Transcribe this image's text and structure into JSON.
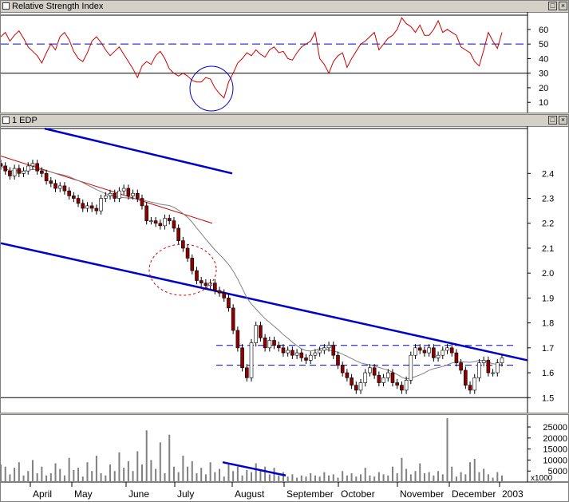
{
  "panes": {
    "rsi": {
      "title": "Relative Strength Index"
    },
    "price": {
      "title": "1 EDP"
    },
    "volume": {
      "title": ""
    }
  },
  "icons": {
    "maximize": "maximize-icon",
    "close": "close-icon"
  },
  "colors": {
    "rsi_line": "#cc0000",
    "trendline": "#0000cc",
    "up_candle": "#ffffff",
    "down_candle": "#8b0000",
    "ma": "#808080",
    "volume_bar": "#808080"
  },
  "x_axis": {
    "months": [
      "April",
      "May",
      "June",
      "July",
      "August",
      "September",
      "October",
      "November",
      "December",
      "2003"
    ]
  },
  "chart_data": [
    {
      "type": "line",
      "title": "Relative Strength Index",
      "ylim": [
        3,
        72
      ],
      "y_ticks": [
        "10",
        "20",
        "30",
        "40",
        "50",
        "60"
      ],
      "reference_lines": [
        50,
        30
      ],
      "series": [
        {
          "values": [
            55,
            58,
            52,
            56,
            59,
            54,
            48,
            45,
            42,
            37,
            44,
            50,
            46,
            55,
            58,
            53,
            45,
            40,
            38,
            44,
            52,
            55,
            51,
            46,
            42,
            45,
            48,
            43,
            38,
            33,
            27,
            35,
            38,
            36,
            42,
            45,
            40,
            33,
            30,
            28,
            30,
            28,
            25,
            24,
            24,
            27,
            26,
            20,
            16,
            13,
            24,
            30,
            37,
            40,
            44,
            42,
            46,
            43,
            41,
            46,
            48,
            44,
            45,
            40,
            39,
            44,
            48,
            50,
            52,
            58,
            40,
            36,
            30,
            38,
            42,
            44,
            34,
            40,
            45,
            50,
            52,
            55,
            58,
            46,
            50,
            54,
            56,
            60,
            68,
            64,
            62,
            58,
            63,
            56,
            56,
            60,
            66,
            58,
            60,
            58,
            56,
            48,
            46,
            44,
            38,
            35,
            46,
            58,
            52,
            47,
            58
          ]
        }
      ]
    },
    {
      "type": "candlestick",
      "title": "1 EDP",
      "ylim": [
        1.44,
        2.59
      ],
      "y_ticks": [
        "1.5",
        "1.6",
        "1.7",
        "1.8",
        "1.9",
        "2.0",
        "2.1",
        "2.2",
        "2.3",
        "2.4"
      ],
      "close": [
        2.43,
        2.41,
        2.39,
        2.42,
        2.4,
        2.41,
        2.43,
        2.44,
        2.41,
        2.4,
        2.37,
        2.36,
        2.34,
        2.35,
        2.33,
        2.31,
        2.3,
        2.28,
        2.26,
        2.27,
        2.26,
        2.25,
        2.3,
        2.31,
        2.32,
        2.3,
        2.33,
        2.34,
        2.31,
        2.32,
        2.3,
        2.27,
        2.21,
        2.21,
        2.2,
        2.19,
        2.22,
        2.21,
        2.18,
        2.13,
        2.1,
        2.06,
        2.01,
        1.97,
        1.96,
        1.95,
        1.96,
        1.93,
        1.92,
        1.9,
        1.86,
        1.77,
        1.7,
        1.62,
        1.58,
        1.72,
        1.79,
        1.74,
        1.7,
        1.73,
        1.71,
        1.7,
        1.68,
        1.69,
        1.67,
        1.68,
        1.66,
        1.65,
        1.67,
        1.68,
        1.69,
        1.7,
        1.71,
        1.67,
        1.63,
        1.6,
        1.58,
        1.55,
        1.53,
        1.56,
        1.6,
        1.62,
        1.59,
        1.56,
        1.58,
        1.6,
        1.56,
        1.55,
        1.53,
        1.57,
        1.67,
        1.7,
        1.69,
        1.68,
        1.7,
        1.66,
        1.67,
        1.69,
        1.7,
        1.68,
        1.64,
        1.61,
        1.55,
        1.53,
        1.58,
        1.64,
        1.65,
        1.6,
        1.6,
        1.64,
        1.66
      ],
      "trendlines": [
        {
          "from": [
            0,
            2.58
          ],
          "to": [
            1,
            2.4
          ]
        },
        {
          "from": [
            0,
            2.12
          ],
          "to": [
            1,
            1.65
          ]
        },
        {
          "from": [
            0,
            2.47
          ],
          "to": [
            1,
            2.2
          ]
        }
      ],
      "horizontal_levels": [
        1.71,
        1.63,
        1.5
      ]
    },
    {
      "type": "bar",
      "title": "",
      "ylim": [
        0,
        29000
      ],
      "y_ticks": [
        "5000",
        "10000",
        "15000",
        "20000",
        "25000"
      ],
      "unit_label": "x1000",
      "values": [
        8000,
        7000,
        3500,
        6500,
        9000,
        3000,
        5000,
        10000,
        4000,
        7000,
        3000,
        4000,
        8500,
        6000,
        3000,
        11000,
        5500,
        6500,
        2500,
        9000,
        5000,
        12000,
        4000,
        3000,
        8000,
        5000,
        13500,
        6500,
        9500,
        5000,
        14000,
        8000,
        23500,
        10000,
        6000,
        18000,
        4000,
        21500,
        7000,
        4500,
        12000,
        7000,
        9500,
        4000,
        6500,
        3500,
        9000,
        4500,
        6000,
        2500,
        8000,
        5000,
        7000,
        3000,
        5500,
        4500,
        8500,
        5000,
        7000,
        3500,
        6500,
        3000,
        4500,
        2500,
        3500,
        2000,
        3000,
        2500,
        4000,
        3000,
        2500,
        4500,
        3000,
        3500,
        2000,
        5000,
        3000,
        4000,
        2500,
        3500,
        6500,
        3000,
        2500,
        4500,
        3500,
        3000,
        7000,
        4000,
        11000,
        6000,
        3500,
        5000,
        8500,
        4000,
        4500,
        3000,
        5000,
        3500,
        29000,
        7000,
        2500,
        4500,
        3500,
        9000,
        10500,
        4500,
        6000,
        3500,
        2000,
        4500,
        3000
      ]
    }
  ]
}
